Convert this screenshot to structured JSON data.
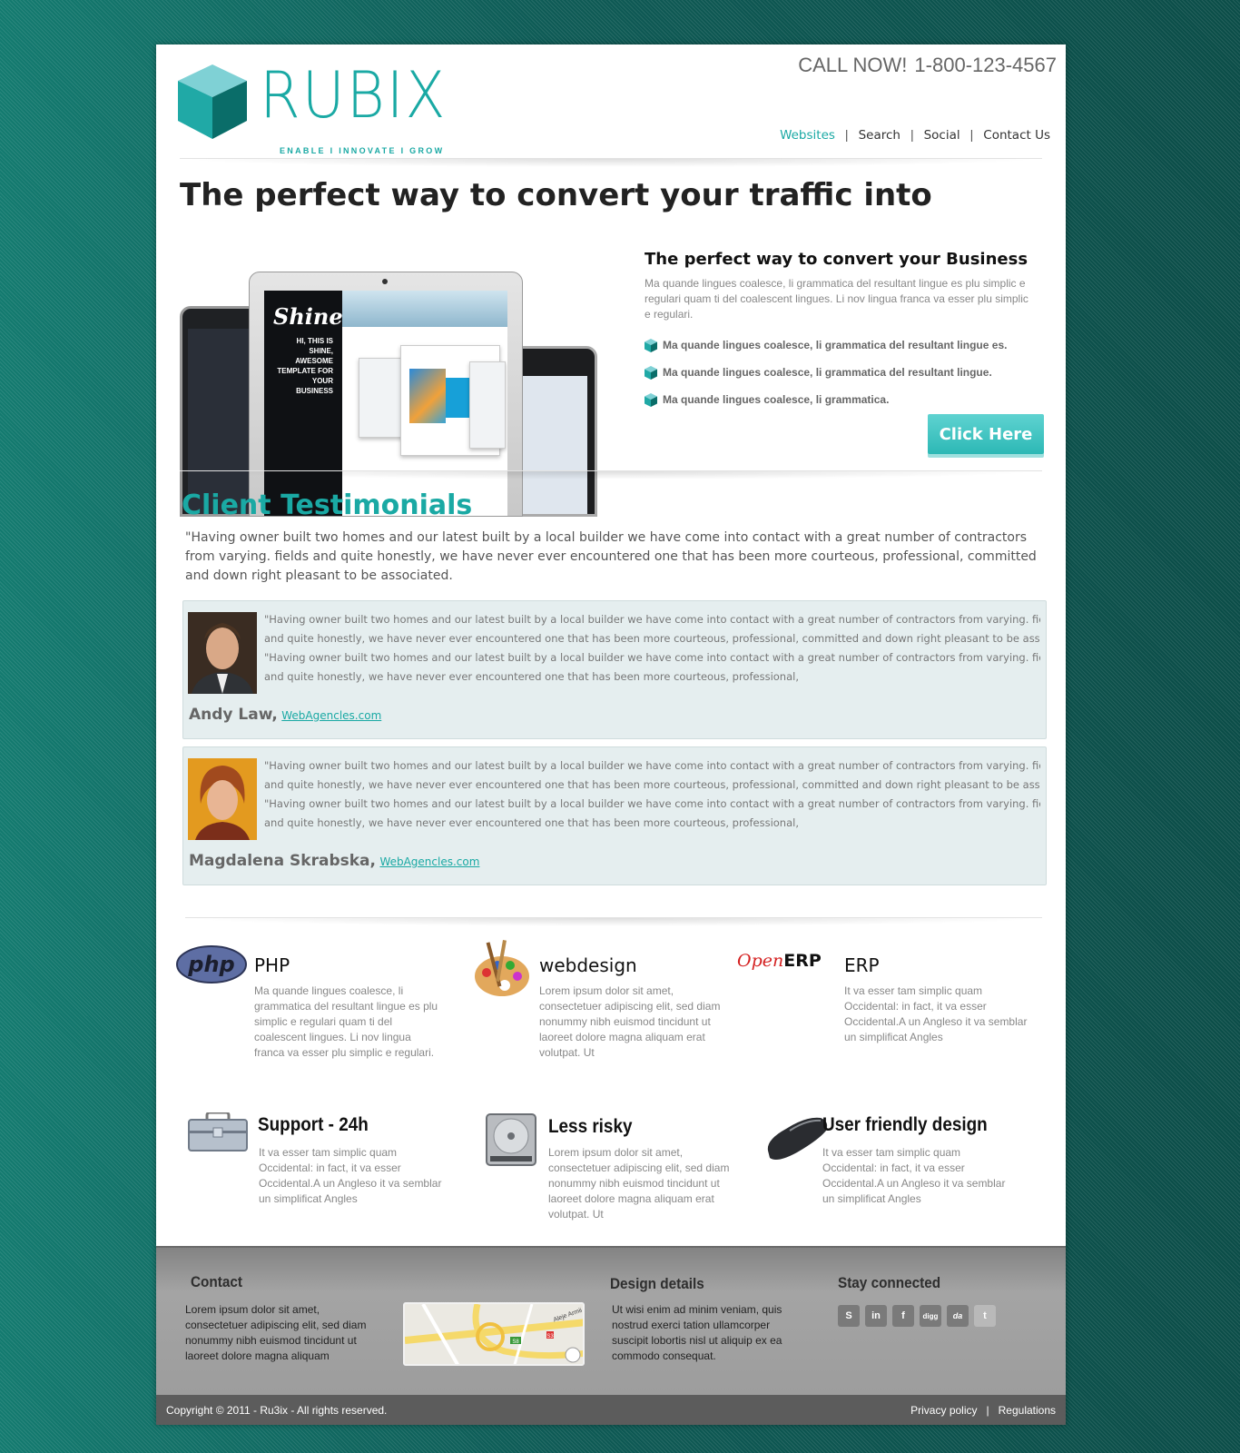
{
  "header": {
    "logo_text": "RUBIX",
    "logo_tagline": "ENABLE  I  INNOVATE  I  GROW",
    "call_label": "CALL NOW!",
    "phone": "1-800-123-4567",
    "nav": [
      {
        "label": "Websites",
        "active": true
      },
      {
        "label": "Search",
        "active": false
      },
      {
        "label": "Social",
        "active": false
      },
      {
        "label": "Contact Us",
        "active": false
      }
    ]
  },
  "hero": {
    "title": "The perfect way to convert your traffic into",
    "screen_brand": "Shine",
    "screen_text": "HI, THIS IS SHINE, AWESOME TEMPLATE FOR YOUR BUSINESS",
    "intro_title": "The perfect way to convert your Business",
    "intro_text": "Ma quande lingues coalesce, li grammatica del resultant lingue es plu simplic e regulari quam ti del coalescent lingues. Li nov lingua franca va esser plu simplic e regulari.",
    "bullets": [
      "Ma quande lingues coalesce, li grammatica del resultant lingue es.",
      "Ma quande lingues coalesce, li grammatica del resultant lingue.",
      "Ma quande lingues coalesce, li grammatica."
    ],
    "cta_label": "Click Here"
  },
  "testimonials": {
    "title": "Client Testimonials",
    "lead": "\"Having owner built two homes and our latest built by a local builder we have come into contact with a great number of contractors from varying. fields and quite honestly, we have never ever encountered one that has been more courteous, professional, committed and down right pleasant to be associated.",
    "items": [
      {
        "lines": [
          "\"Having owner built two homes and our latest built by a local builder we have come into contact with a great number of contractors from varying. fields",
          " and quite honestly, we have never ever encountered one that has been more courteous, professional, committed and down right pleasant to be associa",
          "\"Having owner built two homes and our latest built by a local builder we have come into contact with a great number of contractors from varying. fields",
          "and quite honestly, we have never ever encountered one that has been more courteous, professional,"
        ],
        "name": "Andy Law,",
        "site": "WebAgencles.com"
      },
      {
        "lines": [
          "\"Having owner built two homes and our latest built by a local builder we have come into contact with a great number of contractors from varying. fields",
          " and quite honestly, we have never ever encountered one that has been more courteous, professional, committed and down right pleasant to be associa",
          "\"Having owner built two homes and our latest built by a local builder we have come into contact with a great number of contractors from varying. fields",
          "and quite honestly, we have never ever encountered one that has been more courteous, professional,"
        ],
        "name": "Magdalena Skrabska,",
        "site": "WebAgencles.com"
      }
    ]
  },
  "features": {
    "php": {
      "logo": "php",
      "title": "PHP",
      "text": "Ma quande lingues coalesce, li grammatica del resultant lingue es plu simplic e regulari quam ti del coalescent lingues. Li nov lingua franca va esser plu simplic e regulari."
    },
    "webdesign": {
      "title": "webdesign",
      "text": "Lorem ipsum dolor sit amet, consectetuer adipiscing elit, sed diam nonummy nibh euismod tincidunt ut laoreet dolore magna aliquam erat volutpat. Ut"
    },
    "erp": {
      "logo_open": "Open",
      "logo_erp": "ERP",
      "title": "ERP",
      "text": "It va esser tam simplic quam Occidental: in fact, it va esser Occidental.A un Angleso it va semblar un simplificat Angles"
    },
    "support": {
      "title": "Support - 24h",
      "text": "It va esser tam simplic quam Occidental: in fact, it va esser Occidental.A un Angleso it va semblar un simplificat Angles"
    },
    "risky": {
      "title": "Less risky",
      "text": "Lorem ipsum dolor sit amet, consectetuer adipiscing elit, sed diam nonummy nibh euismod tincidunt ut laoreet dolore magna aliquam erat volutpat. Ut"
    },
    "friendly": {
      "title": "User friendly design",
      "text": "It va esser tam simplic quam Occidental: in fact, it va esser Occidental.A un Angleso it va semblar un simplificat Angles"
    }
  },
  "footer": {
    "contact_title": "Contact",
    "contact_text": "Lorem ipsum dolor sit amet, consectetuer adipiscing elit, sed diam nonummy nibh euismod tincidunt ut laoreet dolore magna aliquam",
    "design_title": "Design details",
    "design_text": "Ut wisi enim ad minim veniam, quis nostrud exerci tation ullamcorper suscipit lobortis nisl ut aliquip ex ea commodo consequat.",
    "social_title": "Stay connected",
    "socials": [
      {
        "icon": "skype-icon",
        "glyph": "S"
      },
      {
        "icon": "linkedin-icon",
        "glyph": "in"
      },
      {
        "icon": "facebook-icon",
        "glyph": "f"
      },
      {
        "icon": "digg-icon",
        "glyph": "digg"
      },
      {
        "icon": "deviantart-icon",
        "glyph": "da"
      },
      {
        "icon": "twitter-icon",
        "glyph": "t"
      }
    ],
    "copyright": "Copyright © 2011 - Ru3ix - All rights reserved.",
    "privacy": "Privacy policy",
    "regulations": "Regulations",
    "map_labels": [
      "Aleje Armii",
      "S8",
      "S3"
    ]
  },
  "colors": {
    "accent": "#1aa9a4",
    "background": "#0f5a54",
    "footer": "#9d9d9d",
    "card": "#e5eeef"
  }
}
